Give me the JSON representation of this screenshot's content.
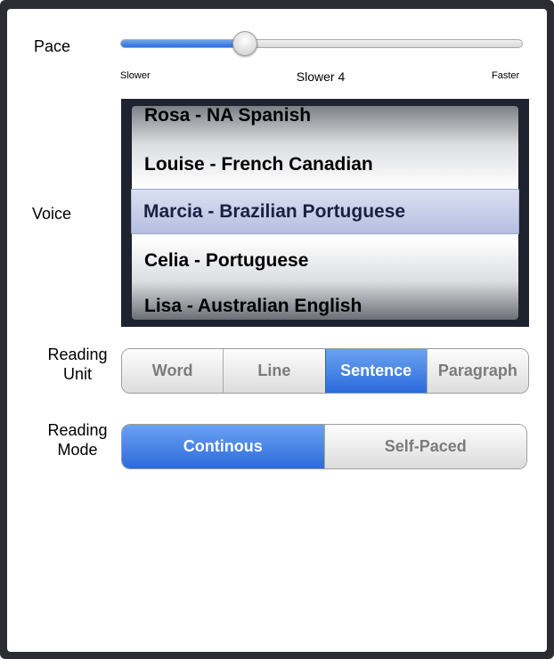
{
  "pace": {
    "label": "Pace",
    "slider_fraction": 0.31,
    "min_label": "Slower",
    "value_label": "Slower 4",
    "max_label": "Faster"
  },
  "voice": {
    "label": "Voice",
    "options": [
      "Rosa - NA Spanish",
      "Louise - French Canadian",
      "Marcia - Brazilian Portuguese",
      "Celia - Portuguese",
      "Lisa - Australian English"
    ],
    "selected": "Marcia - Brazilian Portuguese"
  },
  "reading_unit": {
    "label_line1": "Reading",
    "label_line2": "Unit",
    "segments": [
      "Word",
      "Line",
      "Sentence",
      "Paragraph"
    ],
    "selected": "Sentence"
  },
  "reading_mode": {
    "label_line1": "Reading",
    "label_line2": "Mode",
    "segments": [
      "Continous",
      "Self-Paced"
    ],
    "selected": "Continous"
  },
  "colors": {
    "accent_blue": "#2c6bdb",
    "frame_dark": "#2b2d33"
  }
}
